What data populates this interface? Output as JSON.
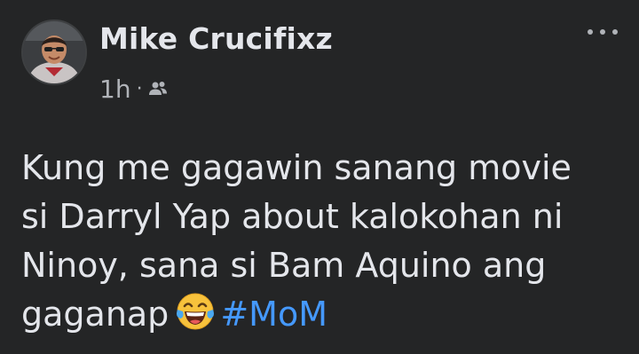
{
  "post": {
    "author": "Mike Crucifixz",
    "timestamp": "1h",
    "separator": "·",
    "audience_icon": "friends-icon",
    "more_icon": "more-options-icon",
    "lines": [
      "Kung me gagawin sanang movie",
      "si Darryl Yap about kalokohan ni",
      "Ninoy, sana si Bam Aquino ang"
    ],
    "last_line_text": "gaganap",
    "emoji_name": "face-with-tears-of-joy-emoji",
    "hashtag": "#MoM"
  },
  "colors": {
    "background": "#242526",
    "primary_text": "#e4e6eb",
    "secondary_text": "#b0b3b8",
    "hashtag": "#4599ff"
  }
}
